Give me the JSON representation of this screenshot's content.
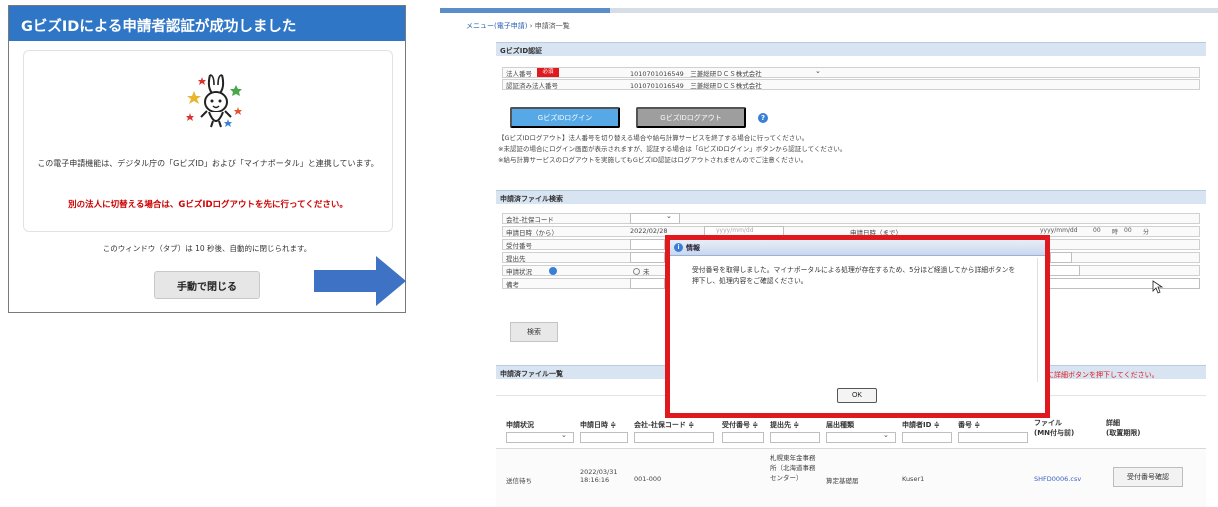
{
  "left_dialog": {
    "header_title": "GビズIDによる申請者認証が成功しました",
    "info_text": "この電子申請機能は、デジタル庁の「GビズID」および「マイナポータル」と連携しています。",
    "warning_text": "別の法人に切替える場合は、GビズIDログアウトを先に行ってください。",
    "auto_close_text": "このウィンドウ（タブ）は 10 秒後、自動的に閉じられます。",
    "manual_close_label": "手動で閉じる",
    "mascot_icon": "rabbit-mascot-icon",
    "accent_color": "#2f76c7"
  },
  "right": {
    "breadcrumb": {
      "link": "メニュー(電子申請)",
      "sep": " › ",
      "current": "申請済一覧"
    },
    "gbiz_section": {
      "title": "GビズID認証",
      "corp_number_label": "法人番号",
      "required_badge": "必須",
      "corp_number_value": "1010701016549　三菱総研ＤＣＳ株式会社",
      "authed_label": "認証済み法人番号",
      "authed_value": "1010701016549　三菱総研ＤＣＳ株式会社",
      "login_label": "GビズIDログイン",
      "logout_label": "GビズIDログアウト",
      "note1": "【GビズIDログアウト】法人番号を切り替える場合や給与計算サービスを終了する場合に行ってください。",
      "note2": "※未認証の場合にログイン画面が表示されますが、認証する場合は「GビズIDログイン」ボタンから認証してください。",
      "note3": "※給与計算サービスのログアウトを実施してもGビズID認証はログアウトされませんのでご注意ください。"
    },
    "search_section": {
      "title": "申請済ファイル検索",
      "fields": [
        "会社-社保コード",
        "申請日時（から）",
        "受付番号",
        "提出先",
        "申請状況",
        "備考"
      ],
      "date_from": "2022/02/28",
      "date_placeholder": "yyyy/mm/dd",
      "date_to_label": "申請日時（まで）",
      "hour_label": "00",
      "hour_unit": "時",
      "min_unit": "分",
      "status_option": "未",
      "search_label": "検索"
    },
    "list_section": {
      "title": "申請済ファイル一覧",
      "red_note": "前に詳細ボタンを押下してください。",
      "columns": [
        "申請状況",
        "申請日時 ≑",
        "会社-社保コード ≑",
        "受付番号 ≑",
        "提出先 ≑",
        "届出種類",
        "申請者ID ≑",
        "番号 ≑",
        "ファイル\n(MN付与前)",
        "詳細\n(取置期限)"
      ],
      "row": {
        "status": "送信待ち",
        "datetime": "2022/03/31 18:16:16",
        "code": "001-000",
        "submit_to": "札幌東年金事務所（北海道事務センター）",
        "kind": "算定基礎届",
        "user": "Kuser1",
        "file": "SHFD0006.csv",
        "detail_label": "受付番号確認"
      }
    },
    "modal": {
      "title": "情報",
      "message": "受付番号を取得しました。マイナポータルによる処理が存在するため、5分ほど経過してから詳細ボタンを押下し、処理内容をご確認ください。",
      "ok_label": "OK",
      "highlight_color": "#e0191f"
    }
  },
  "arrow_color": "#3d72c4"
}
